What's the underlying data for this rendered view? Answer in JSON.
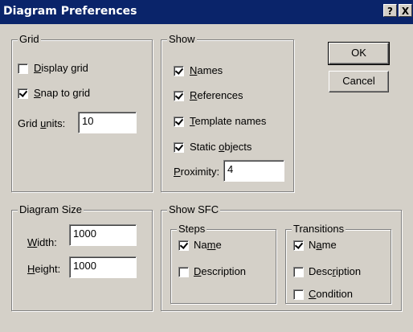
{
  "window": {
    "title": "Diagram Preferences",
    "help_label": "?",
    "close_label": "X"
  },
  "grid": {
    "title": "Grid",
    "display_grid": {
      "pre": "",
      "key": "D",
      "post": "isplay grid",
      "checked": false
    },
    "snap_to_grid": {
      "pre": "",
      "key": "S",
      "post": "nap to grid",
      "checked": true
    },
    "units_label": {
      "pre": "Grid ",
      "key": "u",
      "post": "nits:"
    },
    "units_value": "10"
  },
  "show": {
    "title": "Show",
    "names": {
      "pre": "",
      "key": "N",
      "post": "ames",
      "checked": true
    },
    "references": {
      "pre": "",
      "key": "R",
      "post": "eferences",
      "checked": true
    },
    "template_names": {
      "pre": "",
      "key": "T",
      "post": "emplate names",
      "checked": true
    },
    "static_objects": {
      "pre": "Static ",
      "key": "o",
      "post": "bjects",
      "checked": true
    },
    "proximity_label": {
      "pre": "",
      "key": "P",
      "post": "roximity:"
    },
    "proximity_value": "4"
  },
  "buttons": {
    "ok": "OK",
    "cancel": "Cancel"
  },
  "diagram_size": {
    "title": "Diagram Size",
    "width_label": {
      "pre": "",
      "key": "W",
      "post": "idth:"
    },
    "width_value": "1000",
    "height_label": {
      "pre": "",
      "key": "H",
      "post": "eight:"
    },
    "height_value": "1000"
  },
  "show_sfc": {
    "title": "Show SFC",
    "steps": {
      "title": "Steps",
      "name": {
        "pre": "Na",
        "key": "m",
        "post": "e",
        "checked": true
      },
      "description": {
        "pre": "",
        "key": "D",
        "post": "escription",
        "checked": false
      }
    },
    "transitions": {
      "title": "Transitions",
      "name": {
        "pre": "N",
        "key": "a",
        "post": "me",
        "checked": true
      },
      "description": {
        "pre": "Desc",
        "key": "r",
        "post": "iption",
        "checked": false
      },
      "condition": {
        "pre": "",
        "key": "C",
        "post": "ondition",
        "checked": false
      }
    }
  }
}
